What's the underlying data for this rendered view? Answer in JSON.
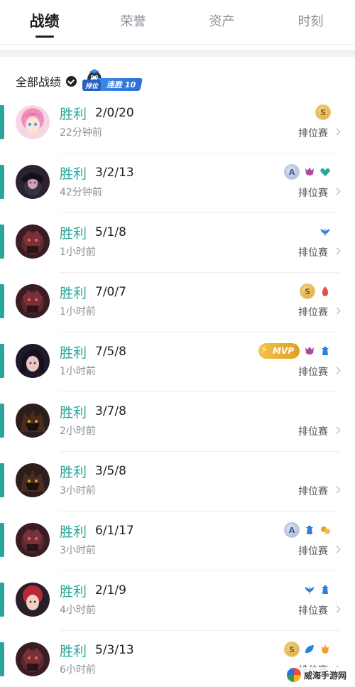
{
  "tabs": [
    {
      "label": "战绩",
      "active": true
    },
    {
      "label": "荣誉",
      "active": false
    },
    {
      "label": "资产",
      "active": false
    },
    {
      "label": "时刻",
      "active": false
    }
  ],
  "filter": {
    "label": "全部战绩",
    "streak_rank_tag": "排位",
    "streak_text": "连胜 10"
  },
  "matches": [
    {
      "result": "胜利",
      "kda": "2/0/20",
      "time": "22分钟前",
      "mode": "排位赛",
      "badges": [
        "gold-medal"
      ]
    },
    {
      "result": "胜利",
      "kda": "3/2/13",
      "time": "42分钟前",
      "mode": "排位赛",
      "badges": [
        "a-medal",
        "demon-icon",
        "heart-icon"
      ]
    },
    {
      "result": "胜利",
      "kda": "5/1/8",
      "time": "1小时前",
      "mode": "排位赛",
      "badges": [
        "wing-icon"
      ]
    },
    {
      "result": "胜利",
      "kda": "7/0/7",
      "time": "1小时前",
      "mode": "排位赛",
      "badges": [
        "gold-medal",
        "fire-icon"
      ]
    },
    {
      "result": "胜利",
      "kda": "7/5/8",
      "time": "1小时前",
      "mode": "排位赛",
      "badges": [
        "mvp-badge",
        "demon-icon",
        "tower-icon"
      ]
    },
    {
      "result": "胜利",
      "kda": "3/7/8",
      "time": "2小时前",
      "mode": "排位赛",
      "badges": []
    },
    {
      "result": "胜利",
      "kda": "3/5/8",
      "time": "3小时前",
      "mode": "排位赛",
      "badges": []
    },
    {
      "result": "胜利",
      "kda": "6/1/17",
      "time": "3小时前",
      "mode": "排位赛",
      "badges": [
        "a-medal",
        "tower-icon",
        "coin-icon"
      ]
    },
    {
      "result": "胜利",
      "kda": "2/1/9",
      "time": "4小时前",
      "mode": "排位赛",
      "badges": [
        "wing-icon",
        "tower-icon"
      ]
    },
    {
      "result": "胜利",
      "kda": "5/3/13",
      "time": "6小时前",
      "mode": "排位赛",
      "badges": [
        "gold-medal",
        "leaf-icon",
        "flame-icon"
      ]
    }
  ],
  "medal_letters": {
    "gold": "S",
    "a": "A"
  },
  "mvp_label": "MVP",
  "watermark_text": "威海手游网",
  "colors": {
    "accent": "#2aa59c",
    "text_primary": "#222222",
    "text_secondary": "#8a8f96",
    "badge_purple": "#b04aa0",
    "badge_teal": "#2aa59c",
    "badge_blue": "#2f7fe0",
    "badge_red": "#e05050",
    "badge_orange": "#f0a020"
  },
  "avatars": [
    "pink-hair-hero",
    "dark-hood-hero",
    "armored-hero",
    "armored-hero",
    "dark-hair-hero",
    "shadow-beast-hero",
    "shadow-beast-hero",
    "armored-hero",
    "red-hair-hero",
    "armored-hero"
  ]
}
